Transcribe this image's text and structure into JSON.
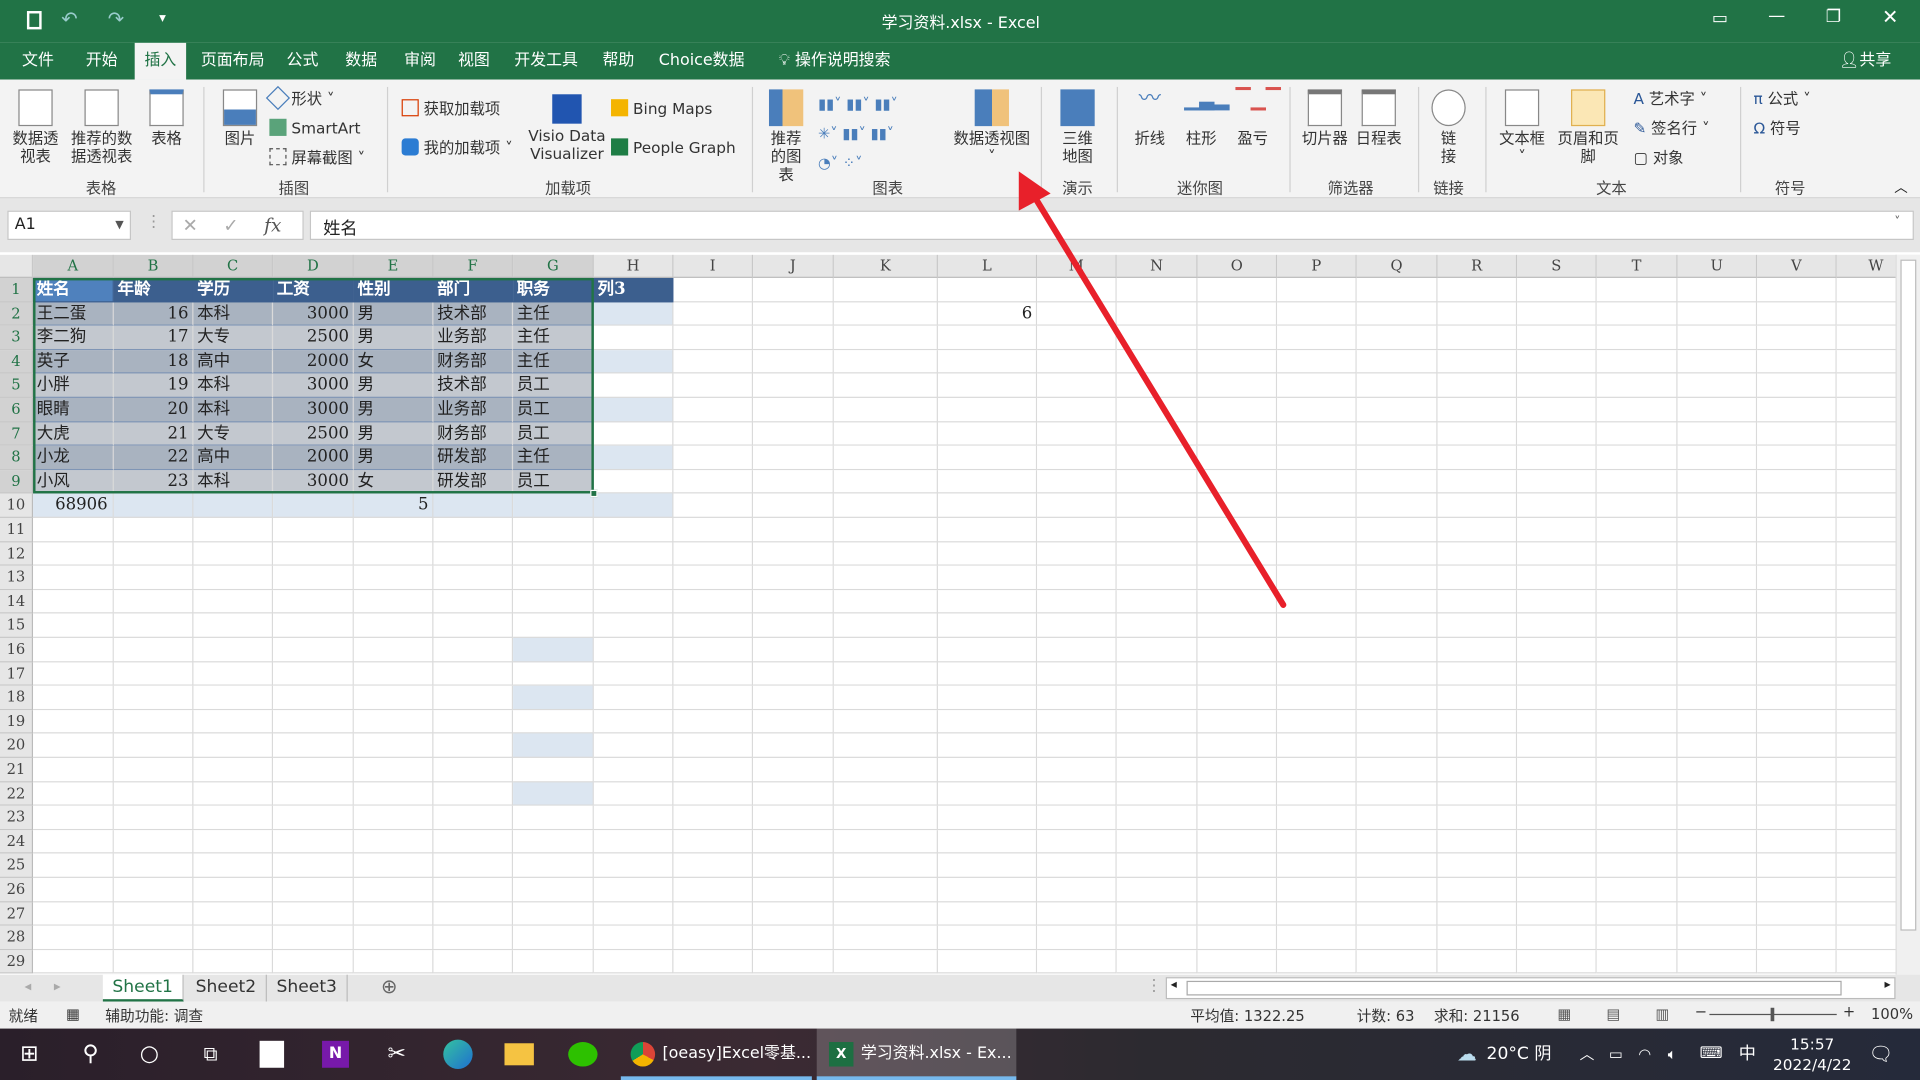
{
  "titlebar": {
    "title": "学习资料.xlsx  -  Excel",
    "qat": [
      "save-icon",
      "undo-icon",
      "redo-icon",
      "customize-icon"
    ]
  },
  "tabs": [
    {
      "label": "文件"
    },
    {
      "label": "开始"
    },
    {
      "label": "插入",
      "active": true
    },
    {
      "label": "页面布局"
    },
    {
      "label": "公式"
    },
    {
      "label": "数据"
    },
    {
      "label": "审阅"
    },
    {
      "label": "视图"
    },
    {
      "label": "开发工具"
    },
    {
      "label": "帮助"
    },
    {
      "label": "Choice数据"
    }
  ],
  "search_label": "操作说明搜索",
  "share_label": "共享",
  "ribbon": {
    "groups": [
      "表格",
      "插图",
      "加载项",
      "图表",
      "演示",
      "迷你图",
      "筛选器",
      "链接",
      "文本",
      "符号"
    ],
    "pivot": "数据透视表",
    "recommended_pivot": "推荐的数据透视表",
    "table": "表格",
    "picture": "图片",
    "shapes": "形状",
    "smartart": "SmartArt",
    "screenshot": "屏幕截图",
    "get_addins": "获取加载项",
    "my_addins": "我的加载项",
    "visio": "Visio Data Visualizer",
    "bing": "Bing Maps",
    "people": "People Graph",
    "rec_charts": "推荐的图表",
    "pivot_chart": "数据透视图",
    "map3d": "三维地图",
    "line": "折线",
    "column": "柱形",
    "winloss": "盈亏",
    "slicer": "切片器",
    "timeline": "日程表",
    "link": "链接",
    "textbox": "文本框",
    "headerfooter": "页眉和页脚",
    "wordart": "艺术字",
    "signature": "签名行",
    "object": "对象",
    "equation": "公式",
    "symbol": "符号"
  },
  "formula_bar": {
    "name_box": "A1",
    "formula": "姓名",
    "fx": "fx"
  },
  "grid": {
    "columns": [
      "A",
      "B",
      "C",
      "D",
      "E",
      "F",
      "G",
      "H",
      "I",
      "J",
      "K",
      "L",
      "M",
      "N",
      "O",
      "P",
      "Q",
      "R",
      "S",
      "T",
      "U",
      "V",
      "W"
    ],
    "row_count": 29,
    "table_header": [
      "姓名",
      "年龄",
      "学历",
      "工资",
      "性别",
      "部门",
      "职务",
      "列3"
    ],
    "table_rows": [
      [
        "王二蛋",
        16,
        "本科",
        3000,
        "男",
        "技术部",
        "主任"
      ],
      [
        "李二狗",
        17,
        "大专",
        2500,
        "男",
        "业务部",
        "主任"
      ],
      [
        "英子",
        18,
        "高中",
        2000,
        "女",
        "财务部",
        "主任"
      ],
      [
        "小胖",
        19,
        "本科",
        3000,
        "男",
        "技术部",
        "员工"
      ],
      [
        "眼睛",
        20,
        "本科",
        3000,
        "男",
        "业务部",
        "员工"
      ],
      [
        "大虎",
        21,
        "大专",
        2500,
        "男",
        "财务部",
        "员工"
      ],
      [
        "小龙",
        22,
        "高中",
        2000,
        "男",
        "研发部",
        "主任"
      ],
      [
        "小风",
        23,
        "本科",
        3000,
        "女",
        "研发部",
        "员工"
      ]
    ],
    "extra_cells": [
      {
        "ref": "L2",
        "value": "6"
      },
      {
        "ref": "A10",
        "value": "68906"
      },
      {
        "ref": "E10",
        "value": "5"
      }
    ],
    "active_cell": "A1",
    "selection": "A1:G9"
  },
  "sheets": [
    {
      "label": "Sheet1",
      "active": true
    },
    {
      "label": "Sheet2"
    },
    {
      "label": "Sheet3"
    }
  ],
  "status": {
    "ready": "就绪",
    "accessibility": "辅助功能: 调查",
    "average": "平均值: 1322.25",
    "count": "计数: 63",
    "sum": "求和: 21156",
    "zoom": "100%"
  },
  "taskbar": {
    "chrome": "[oeasy]Excel零基...",
    "excel": "学习资料.xlsx - Ex...",
    "weather": "20°C  阴",
    "ime": "中",
    "time": "15:57",
    "date": "2022/4/22"
  },
  "colors": {
    "excel_green": "#217346",
    "header_blue": "#3c5f8e",
    "active_blue": "#4f81bd",
    "band_light": "#dce6f1",
    "annotation_red": "#e8202a"
  }
}
